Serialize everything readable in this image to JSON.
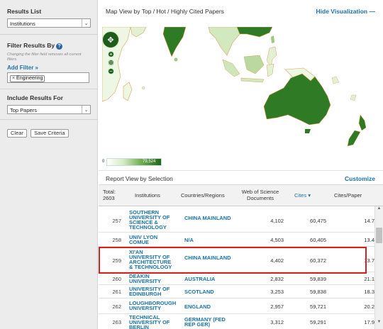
{
  "sidebar": {
    "results_list_label": "Results List",
    "results_list_value": "Institutions",
    "filter_label": "Filter Results By",
    "filter_note": "Changing the filter field removes all current filters.",
    "add_filter": "Add Filter »",
    "active_filter": "Engineering",
    "include_label": "Include Results For",
    "include_value": "Top Papers",
    "clear_button": "Clear",
    "save_button": "Save Criteria"
  },
  "map": {
    "title": "Map View by Top / Hot / Highly Cited Papers",
    "hide_link": "Hide Visualization",
    "legend_min": "0",
    "legend_max": "79,524",
    "colors": {
      "land_light": "#eef6e4",
      "land_mid": "#9cc97f",
      "land_dark": "#2f7a24",
      "ocean": "#ffffff",
      "border": "#d9a35a"
    }
  },
  "report": {
    "title": "Report View by Selection",
    "customize": "Customize"
  },
  "table": {
    "total_label": "Total:",
    "total_value": "2603",
    "headers": {
      "institutions": "Institutions",
      "countries": "Countries/Regions",
      "docs": "Web of Science Documents",
      "cites": "Cites",
      "cites_per_paper": "Cites/Paper"
    },
    "rows": [
      {
        "rank": "257",
        "institution": "SOUTHERN UNIVERSITY OF SCIENCE & TECHNOLOGY",
        "country": "CHINA MAINLAND",
        "docs": "4,102",
        "cites": "60,475",
        "cpp": "14.7"
      },
      {
        "rank": "258",
        "institution": "UNIV LYON COMUE",
        "country": "N/A",
        "docs": "4,503",
        "cites": "60,405",
        "cpp": "13.4"
      },
      {
        "rank": "259",
        "institution": "XI'AN UNIVERSITY OF ARCHITECTURE & TECHNOLOGY",
        "country": "CHINA MAINLAND",
        "docs": "4,402",
        "cites": "60,372",
        "cpp": "13.7"
      },
      {
        "rank": "260",
        "institution": "DEAKIN UNIVERSITY",
        "country": "AUSTRALIA",
        "docs": "2,832",
        "cites": "59,839",
        "cpp": "21.1"
      },
      {
        "rank": "261",
        "institution": "UNIVERSITY OF EDINBURGH",
        "country": "SCOTLAND",
        "docs": "3,253",
        "cites": "59,838",
        "cpp": "18.3"
      },
      {
        "rank": "262",
        "institution": "LOUGHBOROUGH UNIVERSITY",
        "country": "ENGLAND",
        "docs": "2,957",
        "cites": "59,721",
        "cpp": "20.2"
      },
      {
        "rank": "263",
        "institution": "TECHNICAL UNIVERSITY OF BERLIN",
        "country": "GERMANY (FED REP GER)",
        "docs": "3,312",
        "cites": "59,291",
        "cpp": "17.9"
      }
    ]
  }
}
